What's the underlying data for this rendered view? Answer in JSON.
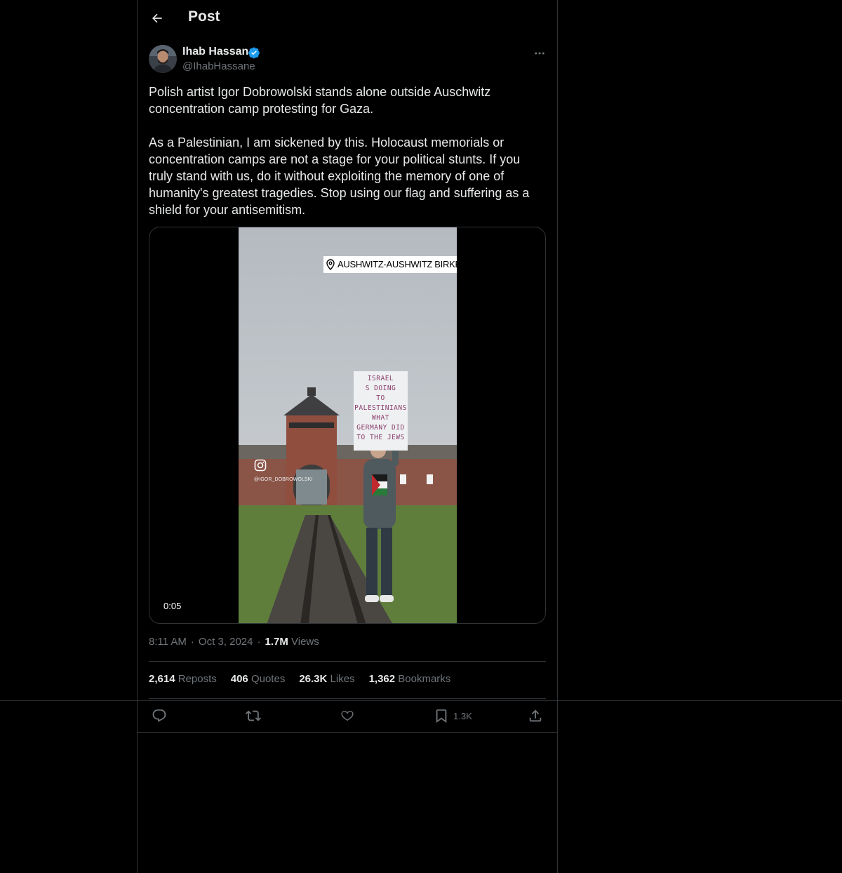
{
  "header": {
    "back_icon": "arrow-left-icon",
    "title": "Post"
  },
  "author": {
    "name": "Ihab Hassan",
    "handle": "@IhabHassane",
    "verified": true,
    "verified_color": "#1d9bf0",
    "more_icon": "more-horizontal-icon"
  },
  "post": {
    "text": "Polish artist Igor Dobrowolski stands alone outside Auschwitz concentration camp protesting for Gaza.\n\nAs a Palestinian, I am sickened by this. Holocaust memorials or concentration camps are not a stage for your political stunts. If you truly stand with us, do it without exploiting the memory of one of humanity's greatest tragedies. Stop using our flag and suffering as a shield for your antisemitism.",
    "video": {
      "location_tag": "AUSHWITZ-AUSHWITZ BIRKENAU",
      "instagram_handle": "@IGOR_DOBROWOLSKI",
      "sign_text": "ISRAEL\nS DOING\nTO\nPALESTINIANS\nWHAT\nGERMANY DID\nTO THE JEWS",
      "time": "0:05"
    }
  },
  "meta": {
    "time": "8:11 AM",
    "date": "Oct 3, 2024",
    "views_count": "1.7M",
    "views_label": "Views"
  },
  "stats": {
    "reposts": {
      "count": "2,614",
      "label": "Reposts"
    },
    "quotes": {
      "count": "406",
      "label": "Quotes"
    },
    "likes": {
      "count": "26.3K",
      "label": "Likes"
    },
    "bookmarks": {
      "count": "1,362",
      "label": "Bookmarks"
    }
  },
  "actions": {
    "reply_icon": "reply-icon",
    "repost_icon": "repost-icon",
    "like_icon": "heart-icon",
    "bookmark_icon": "bookmark-icon",
    "bookmark_count": "1.3K",
    "share_icon": "share-icon"
  },
  "colors": {
    "background": "#000000",
    "text": "#e7e9ea",
    "secondary": "#71767b",
    "border": "#2f3336",
    "accent": "#1d9bf0"
  }
}
